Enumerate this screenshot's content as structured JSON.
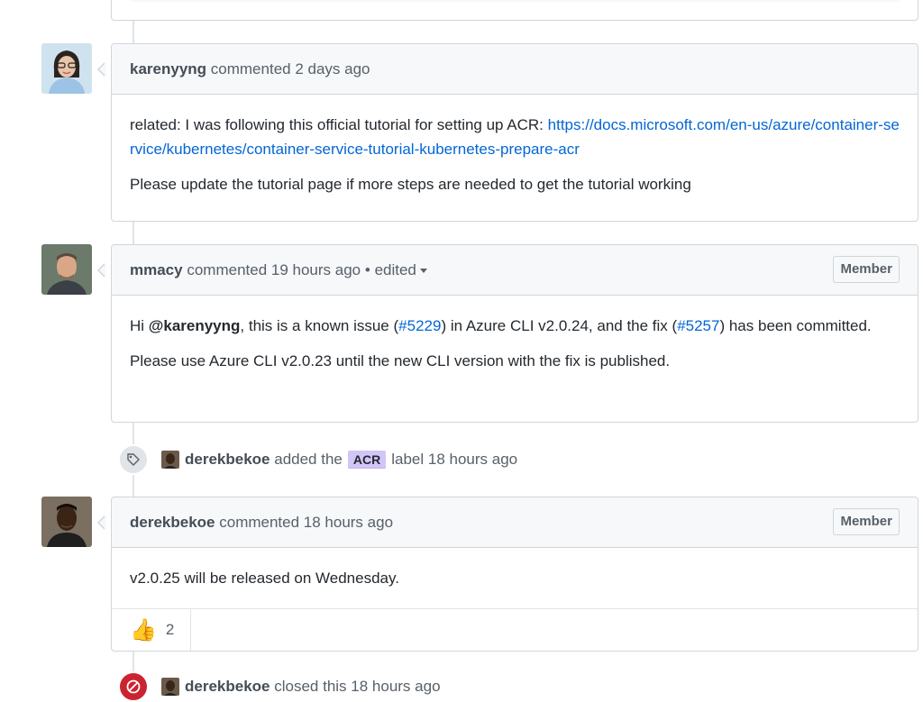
{
  "comments": [
    {
      "author": "karenyyng",
      "action": "commented 2 days ago",
      "body": {
        "p1_text": "related: I was following this official tutorial for setting up ACR: ",
        "p1_link": "https://docs.microsoft.com/en-us/azure/container-service/kubernetes/container-service-tutorial-kubernetes-prepare-acr",
        "p2": "Please update the tutorial page if more steps are needed to get the tutorial working"
      }
    },
    {
      "author": "mmacy",
      "action": "commented 19 hours ago",
      "edited_label": "edited",
      "badge": "Member",
      "body": {
        "p1_a": "Hi ",
        "mention": "@karenyyng",
        "p1_b": ", this is a known issue (",
        "issue_link": "#5229",
        "p1_c": ") in Azure CLI v2.0.24, and the fix (",
        "fix_link": "#5257",
        "p1_d": ") has been committed.",
        "p2": "Please use Azure CLI v2.0.23 until the new CLI version with the fix is published."
      }
    },
    {
      "author": "derekbekoe",
      "action": "commented 18 hours ago",
      "badge": "Member",
      "body": {
        "p1": "v2.0.25 will be released on Wednesday."
      },
      "reactions": {
        "thumbs_up_count": "2"
      }
    }
  ],
  "events": [
    {
      "actor": "derekbekoe",
      "text_before": "added the",
      "label": "ACR",
      "text_after": "label 18 hours ago",
      "icon": "tag-icon"
    },
    {
      "actor": "derekbekoe",
      "text": "closed this 18 hours ago",
      "icon": "closed-icon"
    }
  ],
  "colors": {
    "link": "#0366d6",
    "label_acr": "#d4c5f9",
    "closed": "#cb2431"
  }
}
